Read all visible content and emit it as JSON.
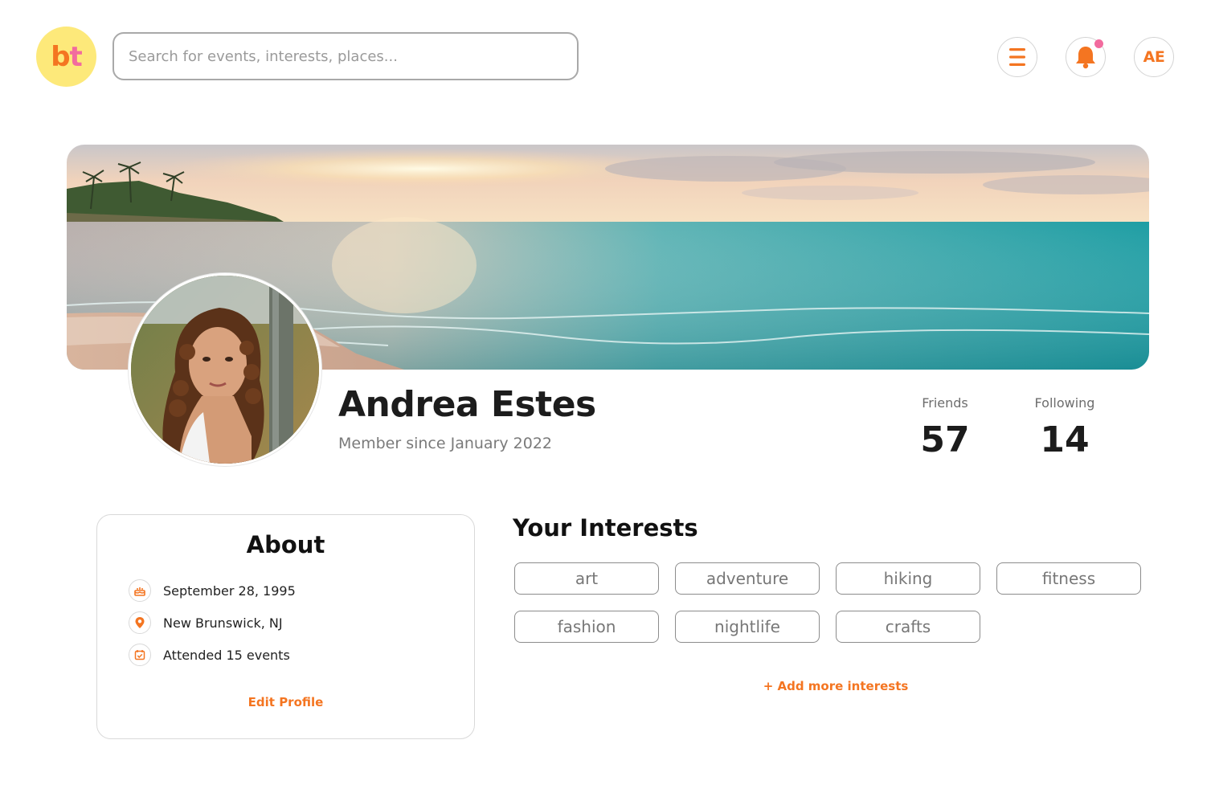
{
  "logo": {
    "letter_b": "b",
    "letter_t": "t"
  },
  "search": {
    "placeholder": "Search for events, interests, places..."
  },
  "header": {
    "avatar_initials": "AE"
  },
  "profile": {
    "name": "Andrea Estes",
    "member_since": "Member since January 2022",
    "stats": [
      {
        "label": "Friends",
        "value": "57"
      },
      {
        "label": "Following",
        "value": "14"
      }
    ]
  },
  "about": {
    "title": "About",
    "rows": [
      {
        "icon": "cake-icon",
        "text": "September 28, 1995"
      },
      {
        "icon": "location-pin-icon",
        "text": "New Brunswick, NJ"
      },
      {
        "icon": "calendar-check-icon",
        "text": "Attended 15 events"
      }
    ],
    "edit_label": "Edit Profile"
  },
  "interests": {
    "title": "Your Interests",
    "items": [
      "art",
      "adventure",
      "hiking",
      "fitness",
      "fashion",
      "nightlife",
      "crafts"
    ],
    "add_label": "+ Add more interests"
  },
  "colors": {
    "accent": "#f47521",
    "pink": "#f26b9e",
    "logo_bg": "#fde97a"
  }
}
